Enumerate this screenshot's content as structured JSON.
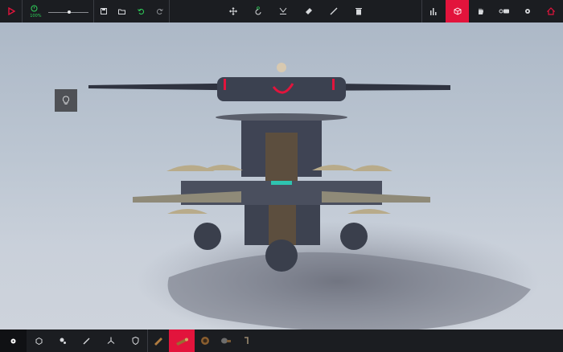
{
  "toolbar": {
    "time_scale_label": "100%",
    "icons": [
      "play-icon",
      "timer-icon",
      "save-icon",
      "load-icon",
      "undo-icon",
      "redo-icon",
      "move-icon",
      "rotate-icon",
      "flip-icon",
      "eraser-icon",
      "wrench-icon",
      "trash-icon",
      "stats-icon",
      "cube-icon",
      "hand-icon",
      "toggle-icon",
      "settings-icon",
      "home-icon"
    ]
  },
  "bottombar": {
    "categories": [
      "gear-icon",
      "core-icon",
      "wheel-icon",
      "wrench-icon",
      "propeller-icon",
      "shield-icon"
    ],
    "parts": [
      "wood-plank-icon",
      "log-icon",
      "round-wood-icon",
      "dome-icon",
      "hinge-icon"
    ]
  },
  "colors": {
    "accent": "#e2143c",
    "bar": "#1b1d21",
    "speed": "#2fd05a"
  },
  "hint": {
    "icon": "lightbulb-icon"
  }
}
